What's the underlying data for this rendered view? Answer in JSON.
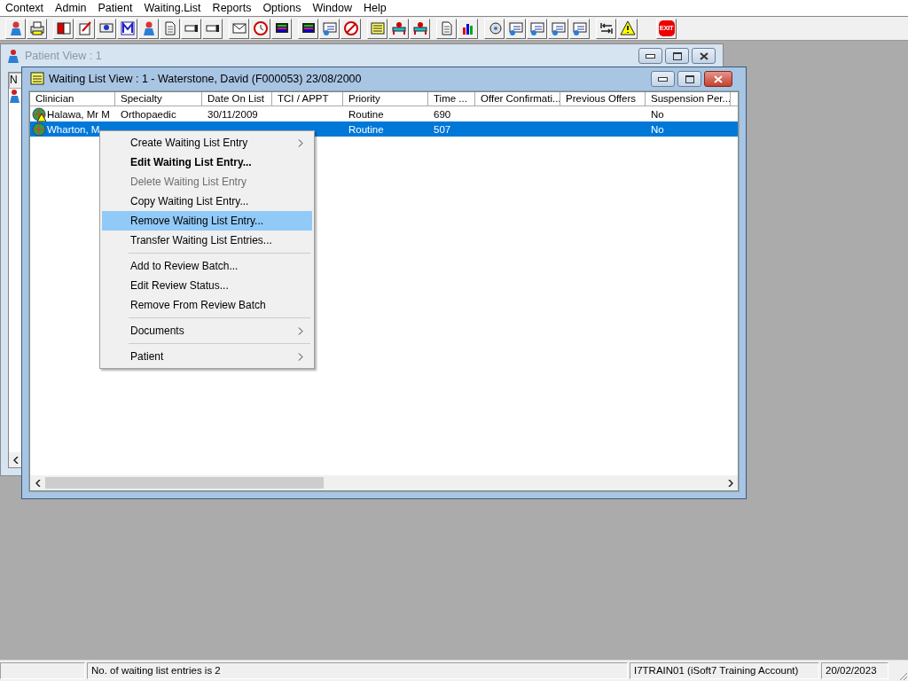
{
  "menu_bar": [
    "Context",
    "Admin",
    "Patient",
    "Waiting.List",
    "Reports",
    "Options",
    "Window",
    "Help"
  ],
  "toolbar": {
    "exit_label": "EXIT"
  },
  "patient_window": {
    "title": "Patient View : 1",
    "column_header": "N"
  },
  "waiting_window": {
    "title": "Waiting List View :  1 - Waterstone, David (F000053) 23/08/2000",
    "columns": [
      "Clinician",
      "Specialty",
      "Date On List",
      "TCI / APPT",
      "Priority",
      "Time ...",
      "Offer Confirmati...",
      "Previous Offers",
      "Suspension Per..."
    ],
    "rows": [
      {
        "selected": false,
        "warning": true,
        "cells": [
          "Halawa, Mr M",
          "Orthopaedic",
          "30/11/2009",
          "",
          "Routine",
          "690",
          "",
          "",
          "No"
        ]
      },
      {
        "selected": true,
        "warning": false,
        "cells": [
          "Wharton, M",
          "",
          "",
          "",
          "Routine",
          "507",
          "",
          "",
          "No"
        ]
      }
    ]
  },
  "context_menu": [
    {
      "kind": "item",
      "label": "Create Waiting List Entry",
      "bold": false,
      "disabled": false,
      "selected": false,
      "submenu": true
    },
    {
      "kind": "item",
      "label": "Edit Waiting List Entry...",
      "bold": true,
      "disabled": false,
      "selected": false,
      "submenu": false
    },
    {
      "kind": "item",
      "label": "Delete Waiting List Entry",
      "bold": false,
      "disabled": true,
      "selected": false,
      "submenu": false
    },
    {
      "kind": "item",
      "label": "Copy Waiting List Entry...",
      "bold": false,
      "disabled": false,
      "selected": false,
      "submenu": false
    },
    {
      "kind": "item",
      "label": "Remove Waiting List Entry...",
      "bold": false,
      "disabled": false,
      "selected": true,
      "submenu": false
    },
    {
      "kind": "item",
      "label": "Transfer Waiting List Entries...",
      "bold": false,
      "disabled": false,
      "selected": false,
      "submenu": false
    },
    {
      "kind": "separator"
    },
    {
      "kind": "item",
      "label": "Add to Review Batch...",
      "bold": false,
      "disabled": false,
      "selected": false,
      "submenu": false
    },
    {
      "kind": "item",
      "label": "Edit Review Status...",
      "bold": false,
      "disabled": false,
      "selected": false,
      "submenu": false
    },
    {
      "kind": "item",
      "label": "Remove From Review Batch",
      "bold": false,
      "disabled": false,
      "selected": false,
      "submenu": false
    },
    {
      "kind": "separator"
    },
    {
      "kind": "item",
      "label": "Documents",
      "bold": false,
      "disabled": false,
      "selected": false,
      "submenu": true
    },
    {
      "kind": "separator"
    },
    {
      "kind": "item",
      "label": "Patient",
      "bold": false,
      "disabled": false,
      "selected": false,
      "submenu": true
    }
  ],
  "status_bar": {
    "message": "No. of waiting list entries is 2",
    "account": "I7TRAIN01 (iSoft7 Training Account)",
    "date": "20/02/2023"
  }
}
